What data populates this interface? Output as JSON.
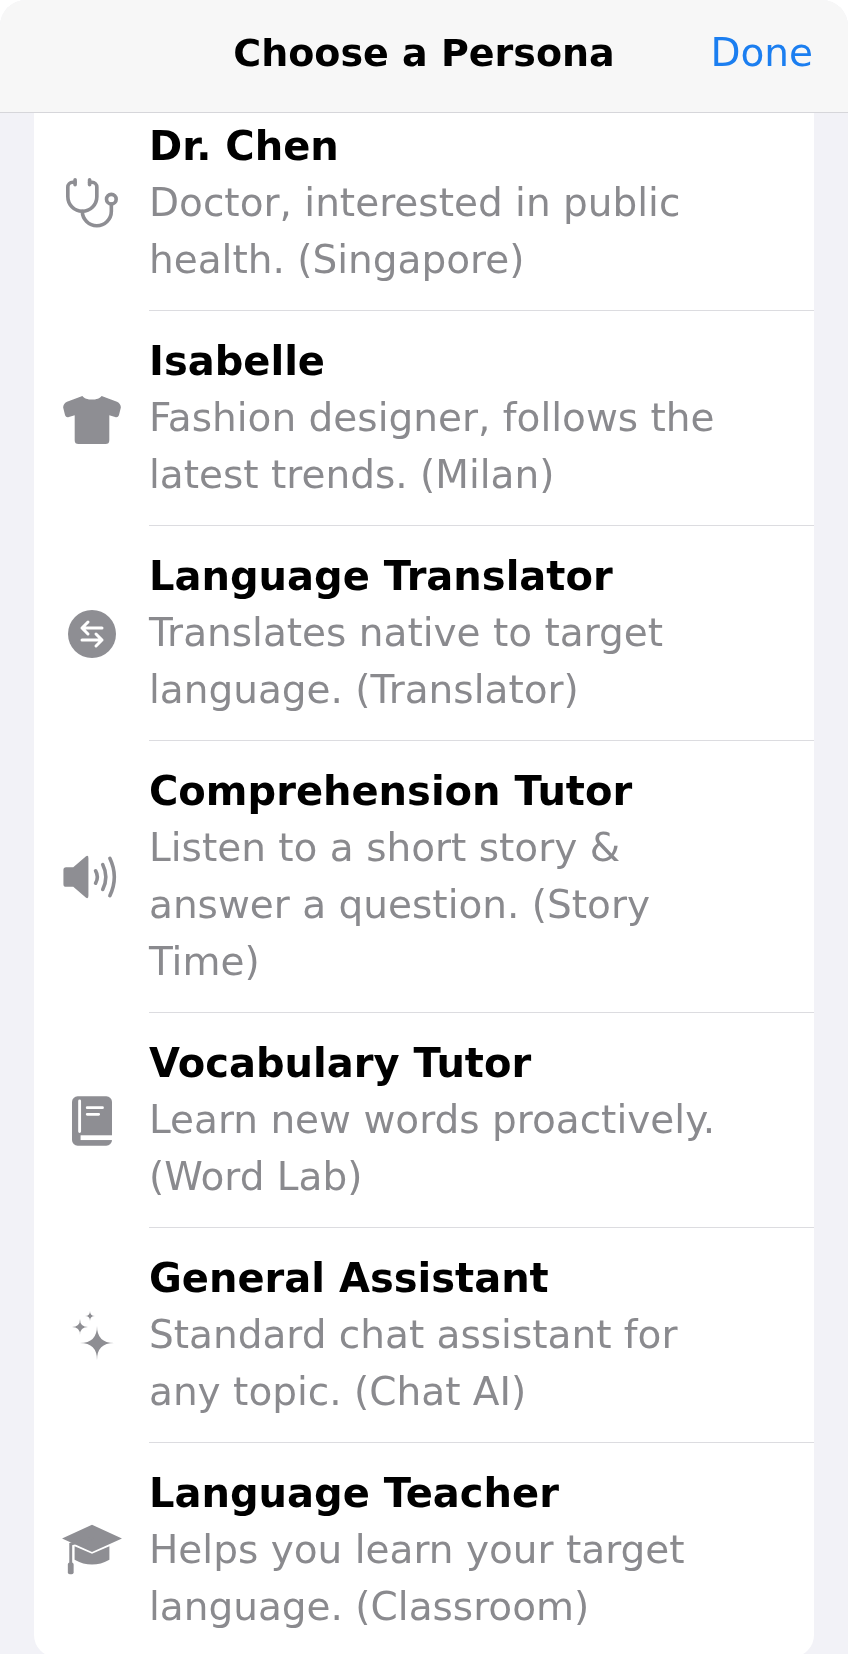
{
  "header": {
    "title": "Choose a Persona",
    "done_button": "Done"
  },
  "personas": [
    {
      "name": "Dr. Chen",
      "description": "Doctor, interested in public health. (Singapore)",
      "selected": false
    },
    {
      "name": "Isabelle",
      "description": "Fashion designer, follows the latest trends. (Milan)",
      "selected": false
    },
    {
      "name": "Language Translator",
      "description": "Translates native to target language. (Translator)",
      "selected": false
    },
    {
      "name": "Comprehension Tutor",
      "description": "Listen to a short story & answer a question. (Story Time)",
      "selected": false
    },
    {
      "name": "Vocabulary Tutor",
      "description": "Learn new words proactively. (Word Lab)",
      "selected": false
    },
    {
      "name": "General Assistant",
      "description": "Standard chat assistant for any topic. (Chat AI)",
      "selected": false
    },
    {
      "name": "Language Teacher",
      "description": "Helps you learn your target language. (Classroom)",
      "selected": false
    }
  ]
}
